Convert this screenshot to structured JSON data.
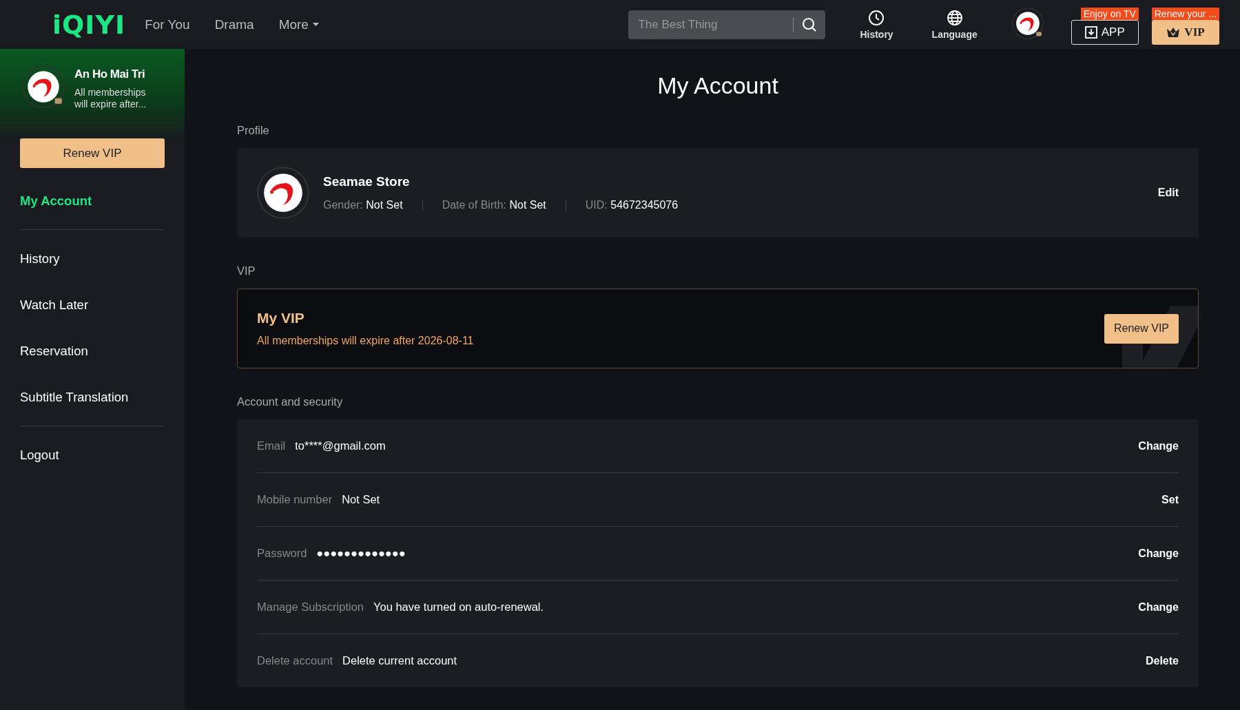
{
  "header": {
    "logo": "iQIYI",
    "nav": [
      {
        "label": "For You",
        "kind": "link",
        "selected": false
      },
      {
        "label": "Drama",
        "kind": "link",
        "selected": false
      },
      {
        "label": "More",
        "kind": "menu",
        "selected": false
      }
    ],
    "search": {
      "placeholder": "The Best Thing"
    },
    "tools": [
      {
        "kind": "history",
        "label": "History"
      },
      {
        "kind": "language",
        "label": "Language"
      }
    ],
    "app_button": {
      "label": "APP",
      "badge": "Enjoy on TV"
    },
    "vip_button": {
      "label": "VIP",
      "badge": "Renew your ..."
    }
  },
  "sidebar": {
    "user": {
      "name": "An Ho Mai Tri",
      "note": "All memberships will expire after..."
    },
    "renew_button": "Renew VIP",
    "items": [
      {
        "label": "My Account",
        "selected": true
      },
      {
        "label": "History",
        "selected": false
      },
      {
        "label": "Watch Later",
        "selected": false
      },
      {
        "label": "Reservation",
        "selected": false
      },
      {
        "label": "Subtitle Translation",
        "selected": false
      },
      {
        "label": "Logout",
        "selected": false
      }
    ]
  },
  "page": {
    "title": "My Account",
    "profile": {
      "heading": "Profile",
      "name": "Seamae Store",
      "fields": [
        {
          "label": "Gender:",
          "value": "Not Set"
        },
        {
          "label": "Date of Birth:",
          "value": "Not Set"
        },
        {
          "label": "UID:",
          "value": "54672345076"
        }
      ],
      "action": "Edit"
    },
    "vip": {
      "heading": "VIP",
      "title": "My VIP",
      "note": "All memberships will expire after 2026-08-11",
      "button": "Renew VIP"
    },
    "security": {
      "heading": "Account and security",
      "rows": [
        {
          "label": "Email",
          "value": "to****@gmail.com",
          "action": "Change"
        },
        {
          "label": "Mobile number",
          "value": "Not Set",
          "action": "Set"
        },
        {
          "label": "Password",
          "value": "●●●●●●●●●●●●●",
          "action": "Change"
        },
        {
          "label": "Manage Subscription",
          "value": "You have turned on auto-renewal.",
          "action": "Change"
        },
        {
          "label": "Delete account",
          "value": "Delete current account",
          "action": "Delete"
        }
      ]
    }
  }
}
